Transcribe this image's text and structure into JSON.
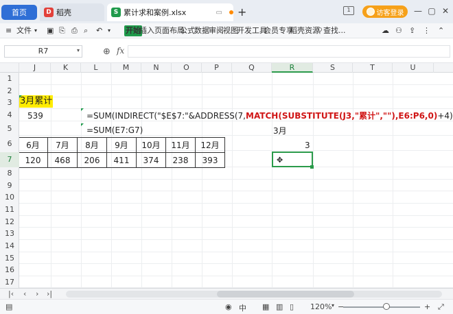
{
  "titlebar": {
    "tabs": [
      {
        "label": "首页"
      },
      {
        "label": "稻壳"
      },
      {
        "label": "累计求和案例.xlsx"
      }
    ],
    "new_tab": "+",
    "layout_badge": "1",
    "login": "访客登录",
    "minimize": "—",
    "maximize": "▢",
    "close": "✕"
  },
  "toolbar": {
    "file": "文件",
    "tabs": [
      "开始",
      "插入",
      "页面布局",
      "公式",
      "数据",
      "审阅",
      "视图",
      "开发工具",
      "会员专享",
      "稻壳资源"
    ],
    "search": "查找..."
  },
  "formula_bar": {
    "cell_ref": "R7",
    "fx": "fx",
    "value": ""
  },
  "grid": {
    "columns": [
      "J",
      "K",
      "L",
      "M",
      "N",
      "O",
      "P",
      "Q",
      "R",
      "S",
      "T",
      "U"
    ],
    "selected_column": "R",
    "rows": [
      "1",
      "2",
      "3",
      "4",
      "5",
      "6",
      "7",
      "8",
      "9",
      "10",
      "11",
      "12",
      "13",
      "14",
      "15",
      "16",
      "17",
      "18"
    ],
    "selected_row": "7"
  },
  "content": {
    "cumulative_label": "3月累计",
    "cumulative_value": "539",
    "formula1_a": "=SUM(INDIRECT(\"$E$7:\"&ADDRESS(7,",
    "formula1_b": "MATCH(SUBSTITUTE(J3,\"累计\",\"\"),E6:P6,0)",
    "formula1_c": "+4)))",
    "formula2": "=SUM(E7:G7)",
    "month_label": "3月",
    "month_number": "3",
    "months": [
      "6月",
      "7月",
      "8月",
      "9月",
      "10月",
      "11月",
      "12月"
    ],
    "values": [
      "120",
      "468",
      "206",
      "411",
      "374",
      "238",
      "393"
    ]
  },
  "statusbar": {
    "zoom": "120%",
    "minus": "−",
    "plus": "+"
  }
}
